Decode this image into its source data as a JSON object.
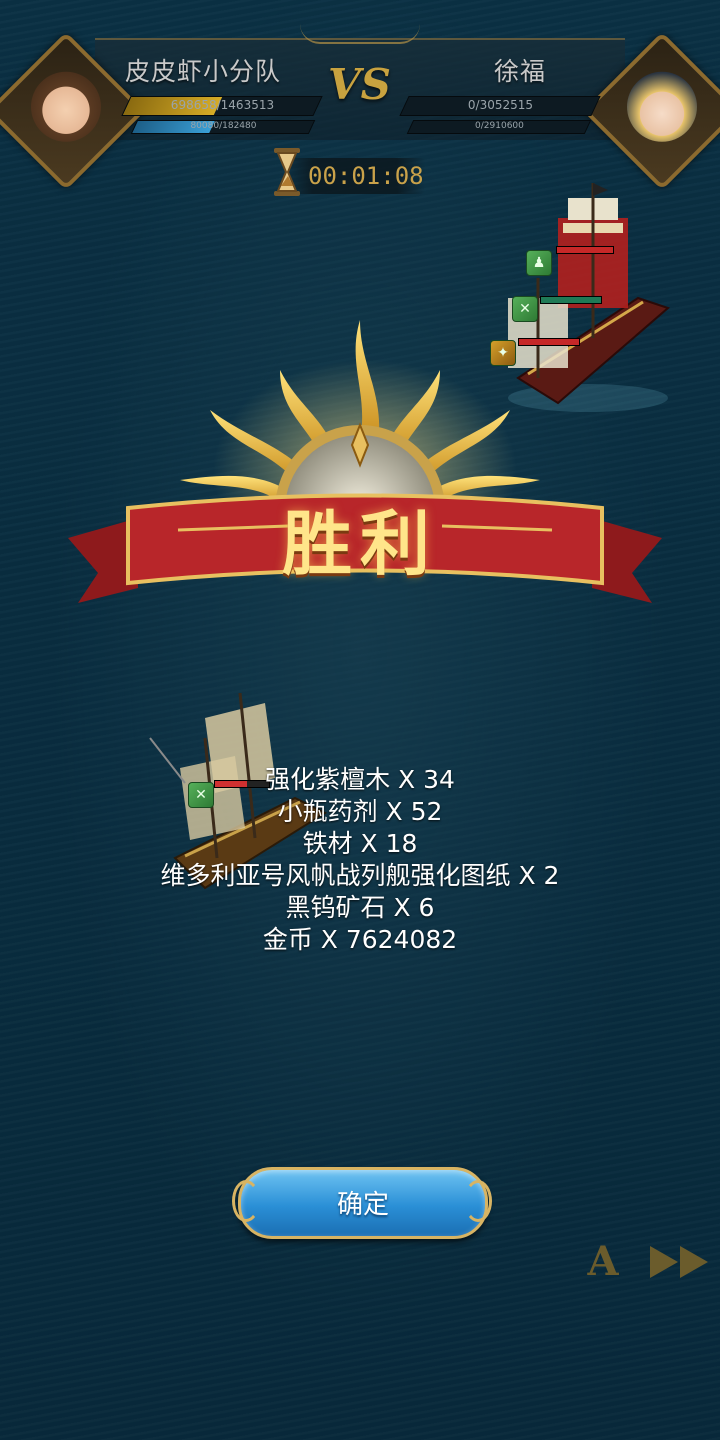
{
  "players": {
    "left": {
      "name": "皮皮虾小分队",
      "hp_text": "698658/1463513",
      "hp_fraction": 0.477,
      "energy_text": "80080/182480",
      "energy_fraction": 0.439
    },
    "right": {
      "name": "徐福",
      "hp_text": "0/3052515",
      "hp_fraction": 0,
      "energy_text": "0/2910600",
      "energy_fraction": 0
    }
  },
  "vs_label": "VS",
  "timer": "00:01:08",
  "result": {
    "title": "胜利"
  },
  "rewards": [
    "强化紫檀木 X 34",
    "小瓶药剂 X 52",
    "铁材 X 18",
    "维多利亚号风帆战列舰强化图纸 X 2",
    "黑钨矿石 X 6",
    "金币 X 7624082"
  ],
  "confirm_button": {
    "label": "确定"
  },
  "controls": {
    "auto_label": "A"
  },
  "colors": {
    "ocean": "#0f3e55",
    "gold": "#c9a24a",
    "hp_yellow": "#c9a020",
    "energy_blue": "#2f8fc6",
    "ribbon_red": "#b8262a",
    "button_blue": "#2a8fd6"
  }
}
